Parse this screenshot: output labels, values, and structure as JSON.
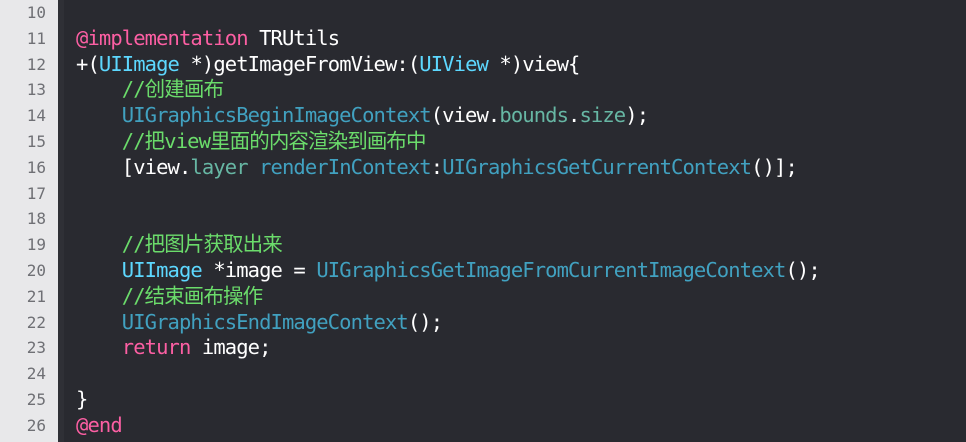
{
  "colors": {
    "background": "#292a30",
    "gutter": "#e8e8ea",
    "keyword": "#fc5fa3",
    "type": "#5dd8ff",
    "function": "#41a1c0",
    "property": "#67b7a4",
    "comment": "#6bdc6b",
    "plain": "#ffffff",
    "line_number": "#6f7075"
  },
  "lines": [
    {
      "num": "10",
      "tokens": []
    },
    {
      "num": "11",
      "tokens": [
        {
          "t": "@implementation",
          "c": "kw"
        },
        {
          "t": " TRUtils",
          "c": "plain"
        }
      ]
    },
    {
      "num": "12",
      "tokens": [
        {
          "t": "+(",
          "c": "plain"
        },
        {
          "t": "UIImage",
          "c": "type"
        },
        {
          "t": " *)getImageFromView:(",
          "c": "plain"
        },
        {
          "t": "UIView",
          "c": "type"
        },
        {
          "t": " *)view{",
          "c": "plain"
        }
      ]
    },
    {
      "num": "13",
      "tokens": [
        {
          "t": "    //创建画布",
          "c": "cmt"
        }
      ]
    },
    {
      "num": "14",
      "tokens": [
        {
          "t": "    ",
          "c": "plain"
        },
        {
          "t": "UIGraphicsBeginImageContext",
          "c": "fn"
        },
        {
          "t": "(view.",
          "c": "plain"
        },
        {
          "t": "bounds",
          "c": "prop"
        },
        {
          "t": ".",
          "c": "plain"
        },
        {
          "t": "size",
          "c": "prop"
        },
        {
          "t": ");",
          "c": "plain"
        }
      ]
    },
    {
      "num": "15",
      "tokens": [
        {
          "t": "    //把view里面的内容渲染到画布中",
          "c": "cmt"
        }
      ]
    },
    {
      "num": "16",
      "tokens": [
        {
          "t": "    [view.",
          "c": "plain"
        },
        {
          "t": "layer",
          "c": "prop"
        },
        {
          "t": " ",
          "c": "plain"
        },
        {
          "t": "renderInContext",
          "c": "fn"
        },
        {
          "t": ":",
          "c": "plain"
        },
        {
          "t": "UIGraphicsGetCurrentContext",
          "c": "fn"
        },
        {
          "t": "()];",
          "c": "plain"
        }
      ]
    },
    {
      "num": "17",
      "tokens": []
    },
    {
      "num": "18",
      "tokens": []
    },
    {
      "num": "19",
      "tokens": [
        {
          "t": "    //把图片获取出来",
          "c": "cmt"
        }
      ]
    },
    {
      "num": "20",
      "tokens": [
        {
          "t": "    ",
          "c": "plain"
        },
        {
          "t": "UIImage",
          "c": "type"
        },
        {
          "t": " *image = ",
          "c": "plain"
        },
        {
          "t": "UIGraphicsGetImageFromCurrentImageContext",
          "c": "fn"
        },
        {
          "t": "();",
          "c": "plain"
        }
      ]
    },
    {
      "num": "21",
      "tokens": [
        {
          "t": "    //结束画布操作",
          "c": "cmt"
        }
      ]
    },
    {
      "num": "22",
      "tokens": [
        {
          "t": "    ",
          "c": "plain"
        },
        {
          "t": "UIGraphicsEndImageContext",
          "c": "fn"
        },
        {
          "t": "();",
          "c": "plain"
        }
      ]
    },
    {
      "num": "23",
      "tokens": [
        {
          "t": "    ",
          "c": "plain"
        },
        {
          "t": "return",
          "c": "kw"
        },
        {
          "t": " image;",
          "c": "plain"
        }
      ]
    },
    {
      "num": "24",
      "tokens": []
    },
    {
      "num": "25",
      "tokens": [
        {
          "t": "}",
          "c": "plain"
        }
      ]
    },
    {
      "num": "26",
      "tokens": [
        {
          "t": "@end",
          "c": "kw"
        }
      ]
    }
  ]
}
